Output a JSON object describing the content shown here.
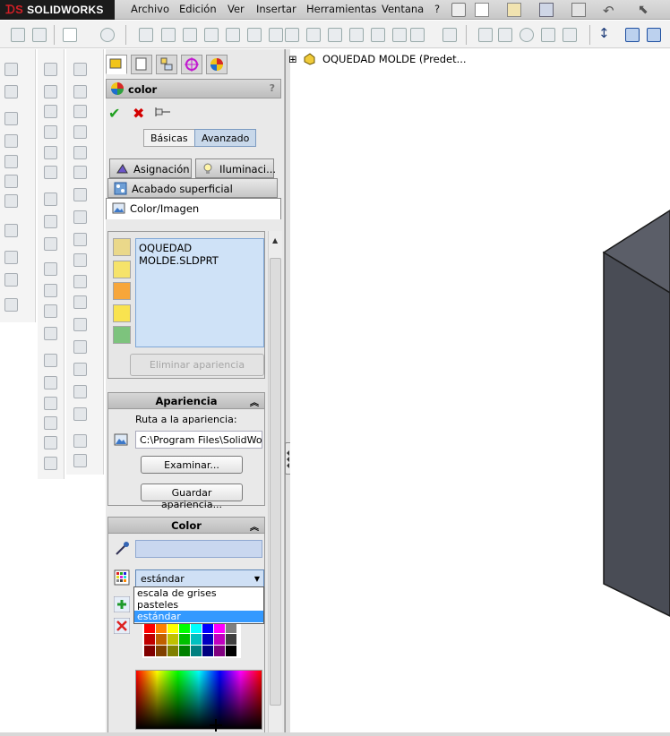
{
  "app": {
    "brand": "SOLIDWORKS"
  },
  "menu": [
    "Archivo",
    "Edición",
    "Ver",
    "Insertar",
    "Herramientas",
    "Ventana",
    "?"
  ],
  "property_manager": {
    "title": "color",
    "help": "?",
    "ok_symbol": "✔",
    "cancel_symbol": "✖",
    "modes": {
      "basic": "Básicas",
      "advanced": "Avanzado"
    },
    "tabs": {
      "assignment": "Asignación",
      "illumination": "Iluminaci...",
      "finish": "Acabado superficial",
      "color_image": "Color/Imagen"
    },
    "list": {
      "item": "OQUEDAD MOLDE.SLDPRT",
      "delete_button": "Eliminar apariencia"
    },
    "appearance": {
      "header": "Apariencia",
      "path_label": "Ruta a la apariencia:",
      "path_value": "C:\\Program Files\\SolidWor",
      "browse_button": "Examinar...",
      "save_button": "Guardar apariencia..."
    },
    "color": {
      "header": "Color",
      "palette_selected": "estándar",
      "palette_options": [
        "escala de grises",
        "pasteles",
        "estándar"
      ]
    }
  },
  "tree": {
    "expand": "⊞",
    "root": "OQUEDAD MOLDE  (Predet..."
  },
  "colors": {
    "accent": "#3399ff",
    "list_bg": "#cfe2f7",
    "model_face": "#4a4d57",
    "model_edge": "#1a1a1a"
  }
}
